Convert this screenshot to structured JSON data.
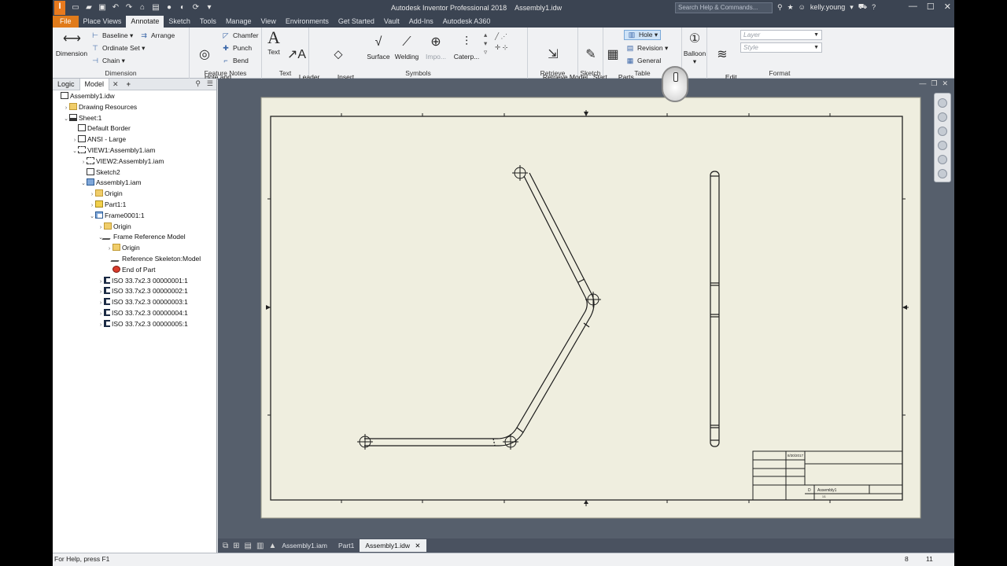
{
  "window": {
    "title": "Autodesk Inventor Professional 2018",
    "document": "Assembly1.idw",
    "search_placeholder": "Search Help & Commands...",
    "user": "kelly.young"
  },
  "menu_tabs": [
    "File",
    "Place Views",
    "Annotate",
    "Sketch",
    "Tools",
    "Manage",
    "View",
    "Environments",
    "Get Started",
    "Vault",
    "Add-Ins",
    "Autodesk A360"
  ],
  "active_tab": "Annotate",
  "ribbon": {
    "dimension": {
      "title": "Dimension",
      "dimension": "Dimension",
      "baseline": "Baseline",
      "ordinate_set": "Ordinate Set",
      "chain": "Chain",
      "arrange": "Arrange"
    },
    "feature_notes": {
      "title": "Feature Notes",
      "hole_thread": "Hole and\nThread",
      "chamfer": "Chamfer",
      "punch": "Punch",
      "bend": "Bend"
    },
    "text": {
      "title": "Text",
      "text": "Text",
      "leader_text": "Leader\nText"
    },
    "symbols": {
      "title": "Symbols",
      "insert_sketch_symbol": "Insert\nSketch Symbol",
      "surface": "Surface",
      "welding": "Welding",
      "import": "Impo...",
      "caterpillar": "Caterp..."
    },
    "retrieve": {
      "title": "Retrieve",
      "retrieve_model": "Retrieve Model\nAnnotations"
    },
    "sketch": {
      "title": "Sketch",
      "start_sketch": "Start\nSketch"
    },
    "table": {
      "title": "Table",
      "parts_list": "Parts\nList",
      "hole": "Hole",
      "revision": "Revision",
      "general": "General"
    },
    "balloon": {
      "balloon": "Balloon"
    },
    "format": {
      "title": "Format",
      "edit_layers": "Edit\nLayers",
      "layer_placeholder": "Layer",
      "style_placeholder": "Style"
    }
  },
  "browser": {
    "tabs": [
      "Logic",
      "Model"
    ],
    "active": "Model",
    "tree": [
      {
        "label": "Assembly1.idw",
        "icon": "doc",
        "depth": 0,
        "twisty": ""
      },
      {
        "label": "Drawing Resources",
        "icon": "folder",
        "depth": 1,
        "twisty": "›"
      },
      {
        "label": "Sheet:1",
        "icon": "sheet",
        "depth": 1,
        "twisty": "⌄"
      },
      {
        "label": "Default Border",
        "icon": "doc",
        "depth": 2,
        "twisty": ""
      },
      {
        "label": "ANSI - Large",
        "icon": "doc",
        "depth": 2,
        "twisty": "›"
      },
      {
        "label": "VIEW1:Assembly1.iam",
        "icon": "view",
        "depth": 2,
        "twisty": "⌄"
      },
      {
        "label": "VIEW2:Assembly1.iam",
        "icon": "view",
        "depth": 3,
        "twisty": "›"
      },
      {
        "label": "Sketch2",
        "icon": "doc",
        "depth": 3,
        "twisty": ""
      },
      {
        "label": "Assembly1.iam",
        "icon": "asm",
        "depth": 3,
        "twisty": "⌄"
      },
      {
        "label": "Origin",
        "icon": "folder",
        "depth": 4,
        "twisty": "›"
      },
      {
        "label": "Part1:1",
        "icon": "part",
        "depth": 4,
        "twisty": "›"
      },
      {
        "label": "Frame0001:1",
        "icon": "frm",
        "depth": 4,
        "twisty": "⌄"
      },
      {
        "label": "Origin",
        "icon": "folder",
        "depth": 5,
        "twisty": "›"
      },
      {
        "label": "Frame Reference Model",
        "icon": "skel",
        "depth": 5,
        "twisty": "⌄"
      },
      {
        "label": "Origin",
        "icon": "folder",
        "depth": 6,
        "twisty": "›"
      },
      {
        "label": "Reference Skeleton:Model",
        "icon": "skel",
        "depth": 6,
        "twisty": ""
      },
      {
        "label": "End of Part",
        "icon": "end",
        "depth": 6,
        "twisty": ""
      },
      {
        "label": "ISO 33.7x2.3 00000001:1",
        "icon": "beam",
        "depth": 5,
        "twisty": "›"
      },
      {
        "label": "ISO 33.7x2.3 00000002:1",
        "icon": "beam",
        "depth": 5,
        "twisty": "›"
      },
      {
        "label": "ISO 33.7x2.3 00000003:1",
        "icon": "beam",
        "depth": 5,
        "twisty": "›"
      },
      {
        "label": "ISO 33.7x2.3 00000004:1",
        "icon": "beam",
        "depth": 5,
        "twisty": "›"
      },
      {
        "label": "ISO 33.7x2.3 00000005:1",
        "icon": "beam",
        "depth": 5,
        "twisty": "›"
      }
    ]
  },
  "title_block": {
    "date": "8/30/2017",
    "size": "D",
    "dwg_title": "Assembly1",
    "scale": "1/1"
  },
  "doc_tabs": [
    "Assembly1.iam",
    "Part1",
    "Assembly1.idw"
  ],
  "active_doc_tab": "Assembly1.idw",
  "status": {
    "help": "For Help, press F1",
    "count1": "8",
    "count2": "11"
  },
  "colors": {
    "sheet": "#efeedf",
    "canvas": "#565f6c",
    "file_tab": "#e07b1b"
  }
}
